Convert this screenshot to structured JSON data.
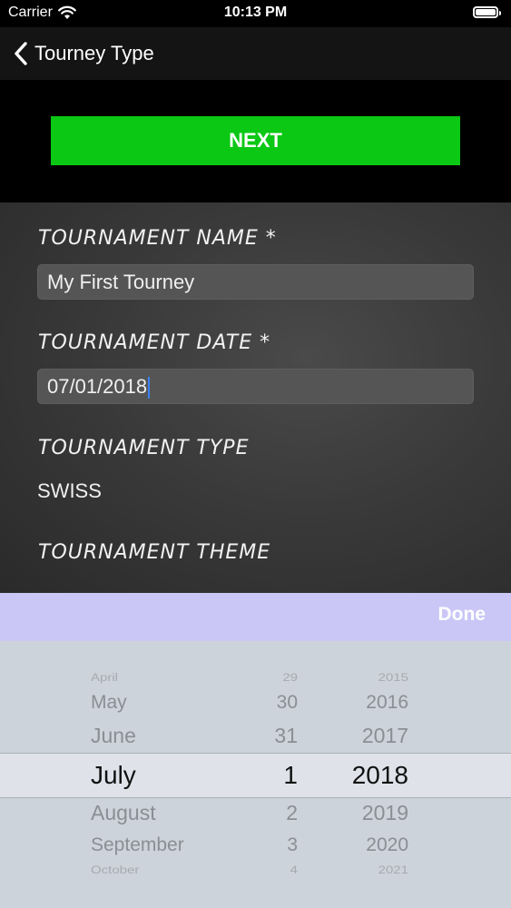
{
  "status_bar": {
    "carrier": "Carrier",
    "time": "10:13 PM",
    "battery_level": 1.0
  },
  "nav": {
    "back_label": "Tourney Type"
  },
  "actions": {
    "next_label": "NEXT"
  },
  "form": {
    "name_label": "TOURNAMENT NAME *",
    "name_value": "My First Tourney",
    "date_label": "TOURNAMENT DATE *",
    "date_value": "07/01/2018",
    "type_label": "TOURNAMENT TYPE",
    "type_value": "SWISS",
    "theme_label": "TOURNAMENT THEME"
  },
  "picker": {
    "done_label": "Done",
    "months": [
      "April",
      "May",
      "June",
      "July",
      "August",
      "September",
      "October"
    ],
    "days": [
      "29",
      "30",
      "31",
      "1",
      "2",
      "3",
      "4"
    ],
    "years": [
      "2015",
      "2016",
      "2017",
      "2018",
      "2019",
      "2020",
      "2021"
    ],
    "selected_index": 3
  },
  "colors": {
    "next_button": "#0ac814",
    "toolbar": "#cac7f6",
    "picker_bg": "#cdd3db"
  }
}
